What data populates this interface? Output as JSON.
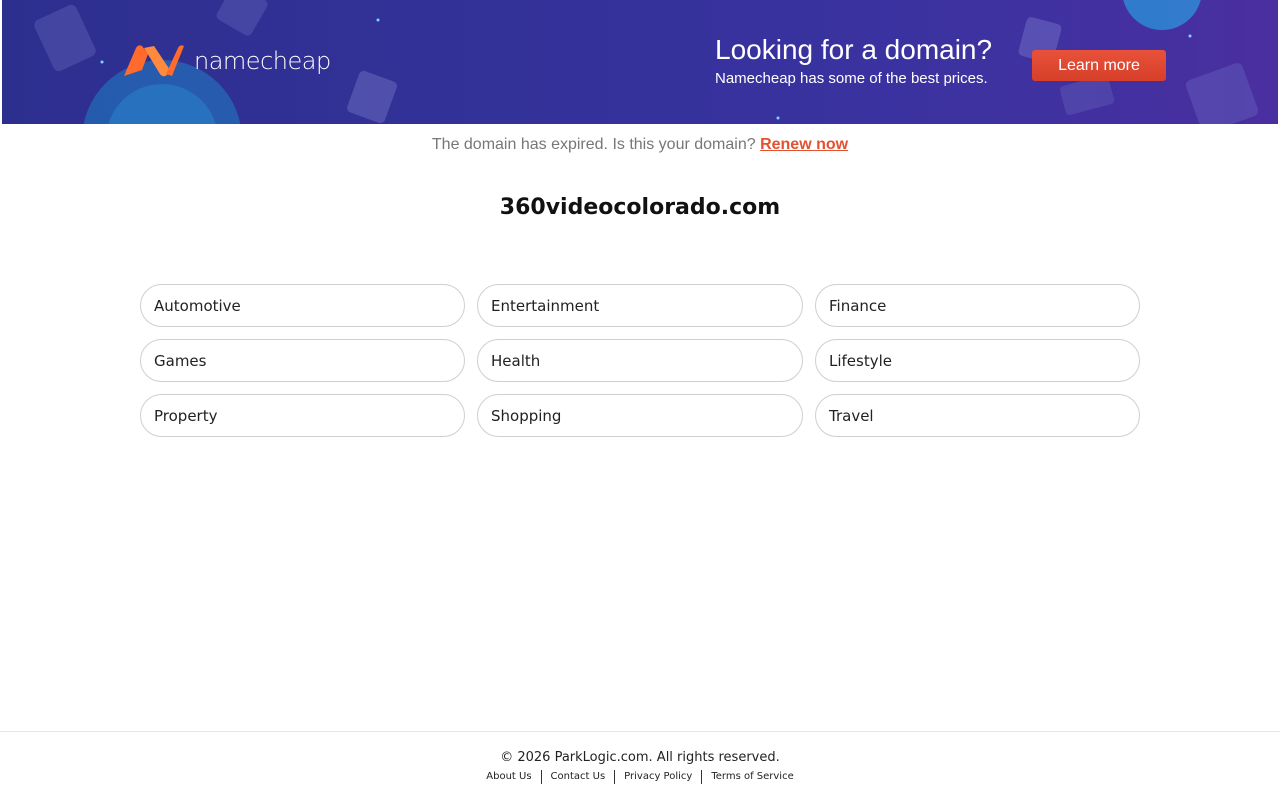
{
  "banner": {
    "logo_text": "namecheap",
    "promo_title": "Looking for a domain?",
    "promo_subtitle": "Namecheap has some of the best prices.",
    "cta_label": "Learn more",
    "colors": {
      "background": "#34329a",
      "cta": "#e04a32",
      "logo_orange": "#ff6b2c"
    }
  },
  "notice": {
    "text": "The domain has expired. Is this your domain?",
    "link_label": "Renew now"
  },
  "domain_name": "360videocolorado.com",
  "categories": [
    "Automotive",
    "Entertainment",
    "Finance",
    "Games",
    "Health",
    "Lifestyle",
    "Property",
    "Shopping",
    "Travel"
  ],
  "footer": {
    "copyright": "© 2026 ParkLogic.com. All rights reserved.",
    "links": [
      "About Us",
      "Contact Us",
      "Privacy Policy",
      "Terms of Service"
    ]
  }
}
